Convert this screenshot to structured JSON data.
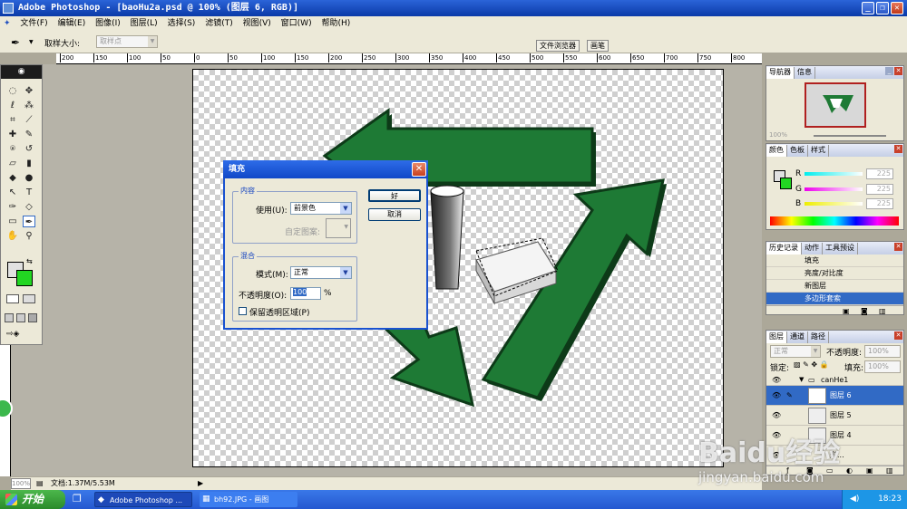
{
  "app": {
    "title": "Adobe Photoshop - [baoHu2a.psd @ 100% (图层 6, RGB)]"
  },
  "menu": [
    "文件(F)",
    "编辑(E)",
    "图像(I)",
    "图层(L)",
    "选择(S)",
    "滤镜(T)",
    "视图(V)",
    "窗口(W)",
    "帮助(H)"
  ],
  "options": {
    "sample_size_label": "取样大小:",
    "sample_size_value": "取样点",
    "file_browser_tab": "文件浏览器",
    "brush_tab": "画笔"
  },
  "ruler": {
    "h_ticks": [
      "200",
      "150",
      "100",
      "50",
      "0",
      "50",
      "100",
      "150",
      "200",
      "250",
      "300",
      "350",
      "400",
      "450",
      "500",
      "550",
      "600",
      "650",
      "700",
      "750",
      "800"
    ]
  },
  "status": {
    "zoom": "100%",
    "doc_info": "文档:1.37M/5.53M"
  },
  "taskbar": {
    "start": "开始",
    "task1": "Adobe Photoshop ...",
    "task2": "bh92.JPG - 画图",
    "clock": "18:23"
  },
  "navigator": {
    "tab_nav": "导航器",
    "tab_info": "信息",
    "zoom": "100%"
  },
  "color": {
    "tab_color": "颜色",
    "tab_swatches": "色板",
    "tab_styles": "样式",
    "channels": [
      {
        "label": "R",
        "value": "225"
      },
      {
        "label": "G",
        "value": "225"
      },
      {
        "label": "B",
        "value": "225"
      }
    ]
  },
  "history": {
    "tab_history": "历史记录",
    "tab_actions": "动作",
    "tab_presets": "工具预设",
    "items": [
      "填充",
      "亮度/对比度",
      "新图层",
      "多边形套索"
    ]
  },
  "layers": {
    "tab_layers": "图层",
    "tab_channels": "通道",
    "tab_paths": "路径",
    "blend_mode": "正常",
    "opacity_label": "不透明度:",
    "opacity_value": "100%",
    "lock_label": "锁定:",
    "fill_label": "填充:",
    "fill_value": "100%",
    "group_name": "canHe1",
    "items": [
      "图层 6",
      "图层 5",
      "图层 4",
      "形..."
    ]
  },
  "dialog": {
    "title": "填充",
    "content_group": "内容",
    "use_label": "使用(U):",
    "use_value": "前景色",
    "custom_pattern_label": "自定图案:",
    "blend_group": "混合",
    "mode_label": "模式(M):",
    "mode_value": "正常",
    "opacity_label": "不透明度(O):",
    "opacity_value": "100",
    "percent": "%",
    "preserve_label": "保留透明区域(P)",
    "ok": "好",
    "cancel": "取消"
  },
  "watermark": {
    "brand": "Baidu经验",
    "url": "jingyan.baidu.com"
  },
  "colors": {
    "arrow_green": "#1e7a35",
    "arrow_dark": "#0d3a18",
    "selection_blue": "#3a6ad0"
  }
}
